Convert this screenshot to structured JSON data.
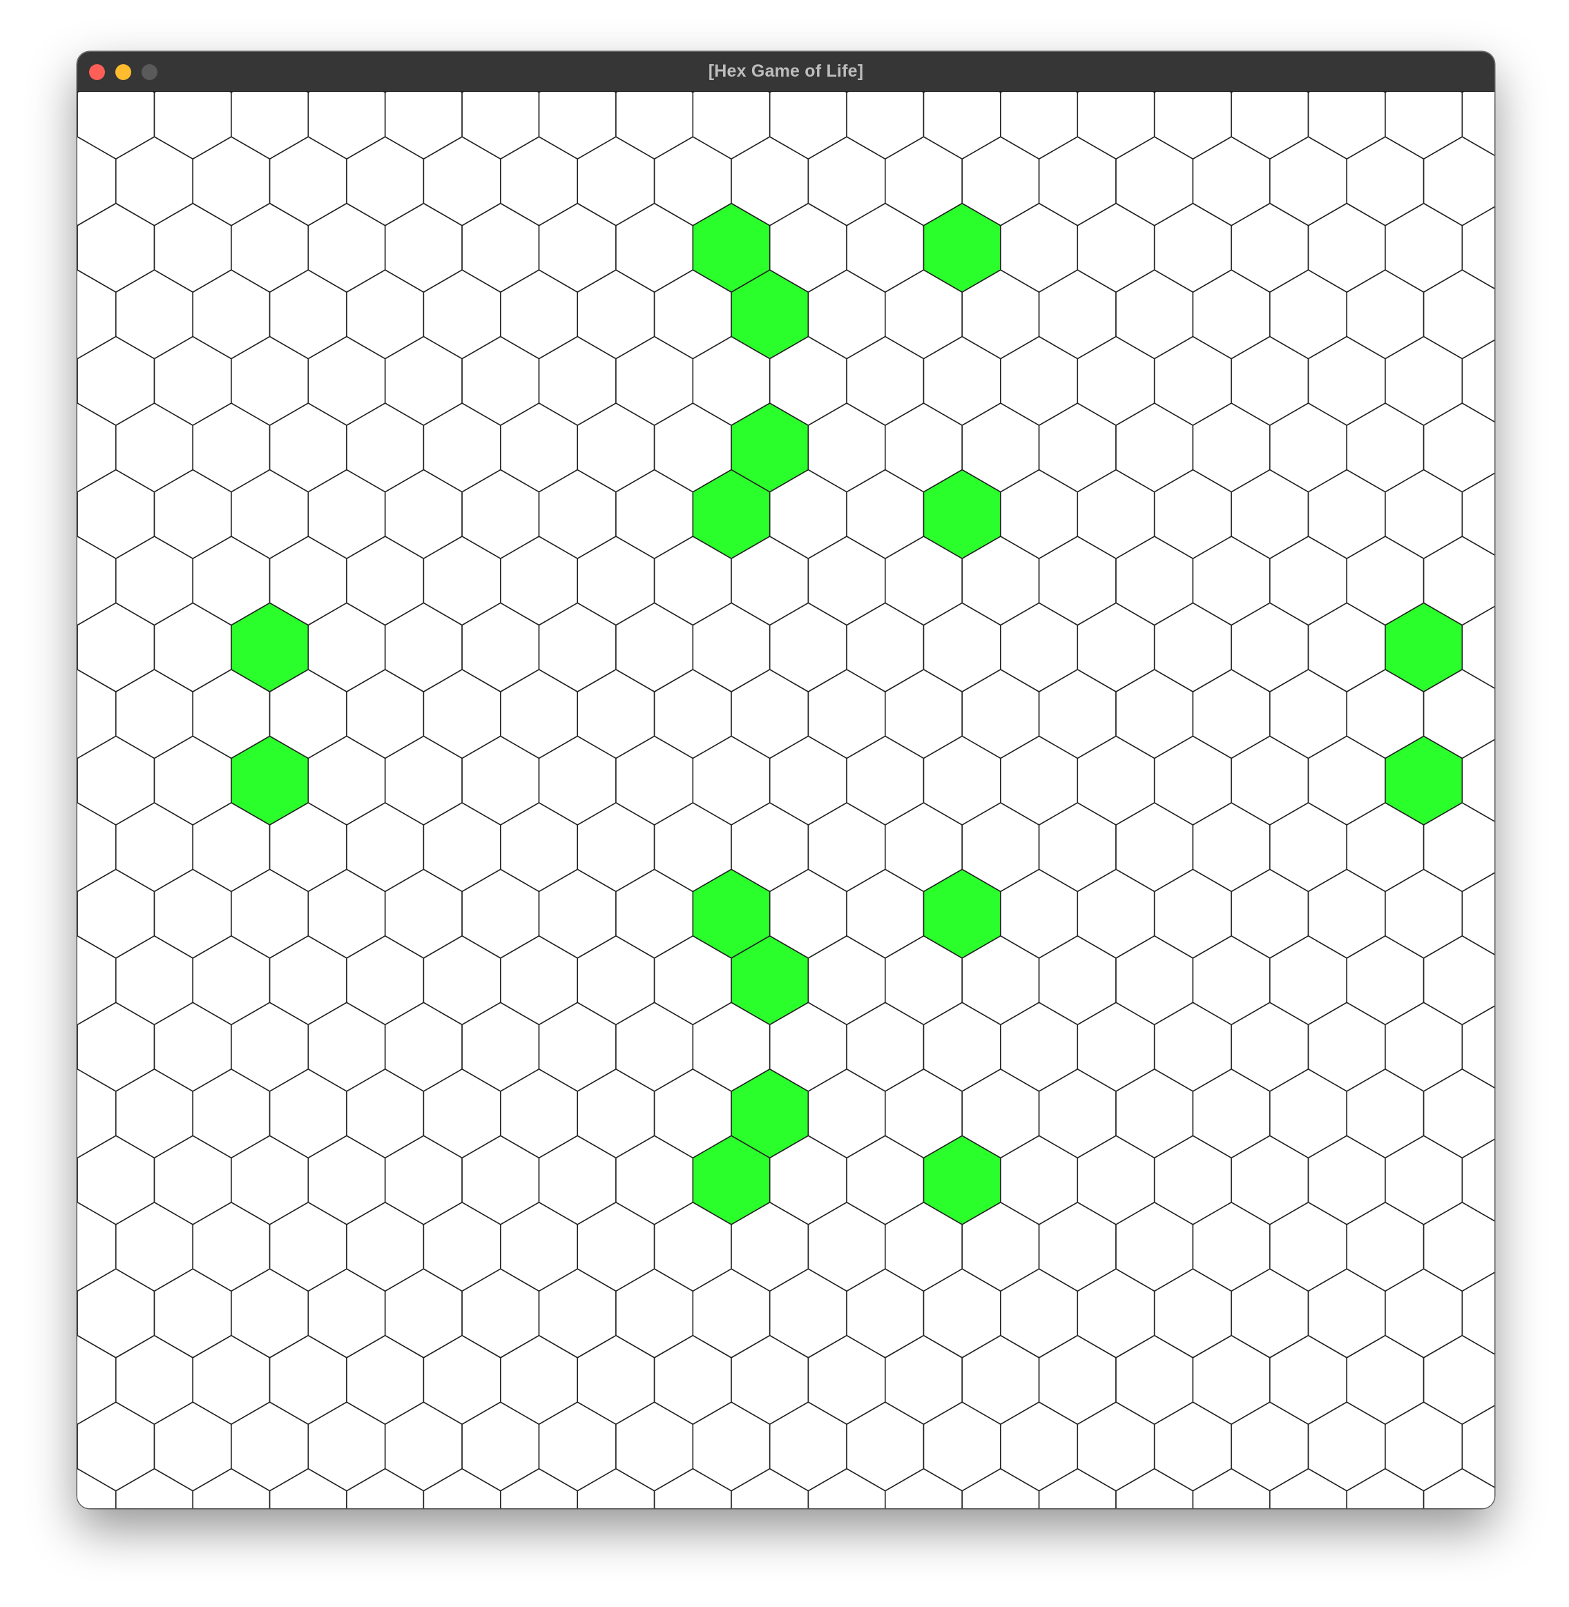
{
  "window": {
    "title": "[Hex Game of Life]",
    "traffic_lights": [
      {
        "name": "close",
        "color": "#ff5f57"
      },
      {
        "name": "minimize",
        "color": "#febc2e"
      },
      {
        "name": "zoom",
        "color": "#5a5a5a"
      }
    ]
  },
  "board": {
    "alive_color": "#2bff2b",
    "dead_color": "#ffffff",
    "grid_line_color": "#222222",
    "alive_cells": [
      {
        "col": 7,
        "row": 2
      },
      {
        "col": 10,
        "row": 2
      },
      {
        "col": 8,
        "row": 3
      },
      {
        "col": 8,
        "row": 5
      },
      {
        "col": 7,
        "row": 6
      },
      {
        "col": 10,
        "row": 6
      },
      {
        "col": 1,
        "row": 8
      },
      {
        "col": 16,
        "row": 8
      },
      {
        "col": 1,
        "row": 10
      },
      {
        "col": 16,
        "row": 10
      },
      {
        "col": 7,
        "row": 12
      },
      {
        "col": 10,
        "row": 12
      },
      {
        "col": 8,
        "row": 13
      },
      {
        "col": 8,
        "row": 15
      },
      {
        "col": 7,
        "row": 16
      },
      {
        "col": 10,
        "row": 16
      }
    ]
  }
}
